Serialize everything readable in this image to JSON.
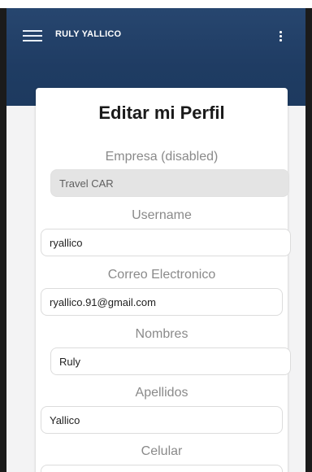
{
  "header": {
    "title": "RULY YALLICO",
    "menu_icon": "hamburger-menu-icon",
    "more_icon": "more-vertical-icon",
    "bg_color": "#1f3c63"
  },
  "form": {
    "title": "Editar mi Perfil",
    "fields": [
      {
        "label": "Empresa (disabled)",
        "value": "Travel CAR",
        "disabled": true
      },
      {
        "label": "Username",
        "value": "ryallico"
      },
      {
        "label": "Correo Electronico",
        "value": "ryallico.91@gmail.com"
      },
      {
        "label": "Nombres",
        "value": "Ruly"
      },
      {
        "label": "Apellidos",
        "value": "Yallico"
      },
      {
        "label": "Celular",
        "value": ""
      }
    ]
  }
}
